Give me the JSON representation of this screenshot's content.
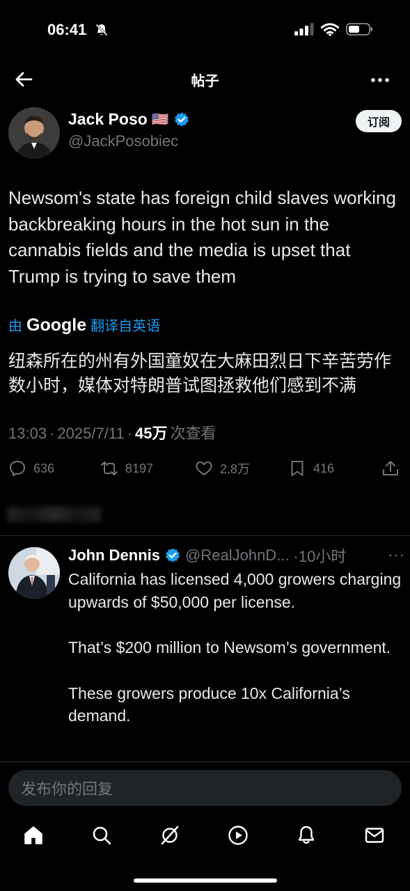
{
  "status_bar": {
    "time": "06:41"
  },
  "header": {
    "title": "帖子"
  },
  "post": {
    "author_name": "Jack Poso",
    "author_flag": "🇺🇸",
    "author_handle": "@JackPosobiec",
    "subscribe_label": "订阅",
    "text": "Newsom's state has foreign child slaves working backbreaking hours in the hot sun in the cannabis fields and the media is upset that Trump is trying to save them",
    "translate_prefix": "由",
    "translate_brand": "Google",
    "translate_suffix": "翻译自英语",
    "translated_text": "纽森所在的州有外国童奴在大麻田烈日下辛苦劳作数小时，媒体对特朗普试图拯救他们感到不满",
    "time": "13:03",
    "date": "2025/7/11",
    "views": "45万",
    "views_label": "次查看",
    "replies": "636",
    "reposts": "8197",
    "likes": "2.8万",
    "bookmarks": "416"
  },
  "reply": {
    "author_name": "John Dennis",
    "author_handle": "@RealJohnD...",
    "time_ago": "·10小时",
    "paragraphs": [
      "California has licensed 4,000 growers charging upwards of $50,000 per license.",
      "That’s $200 million to Newsom’s government.",
      "These growers produce 10x California’s demand."
    ]
  },
  "reply_input": {
    "placeholder": "发布你的回复"
  },
  "tabs": [
    "home-icon",
    "search-icon",
    "grok-icon",
    "video-icon",
    "notifications-icon",
    "messages-icon"
  ],
  "colors": {
    "background": "#000000",
    "accent": "#1d9bf0",
    "text_secondary": "#71767b",
    "verified": "#1d9bf0"
  }
}
